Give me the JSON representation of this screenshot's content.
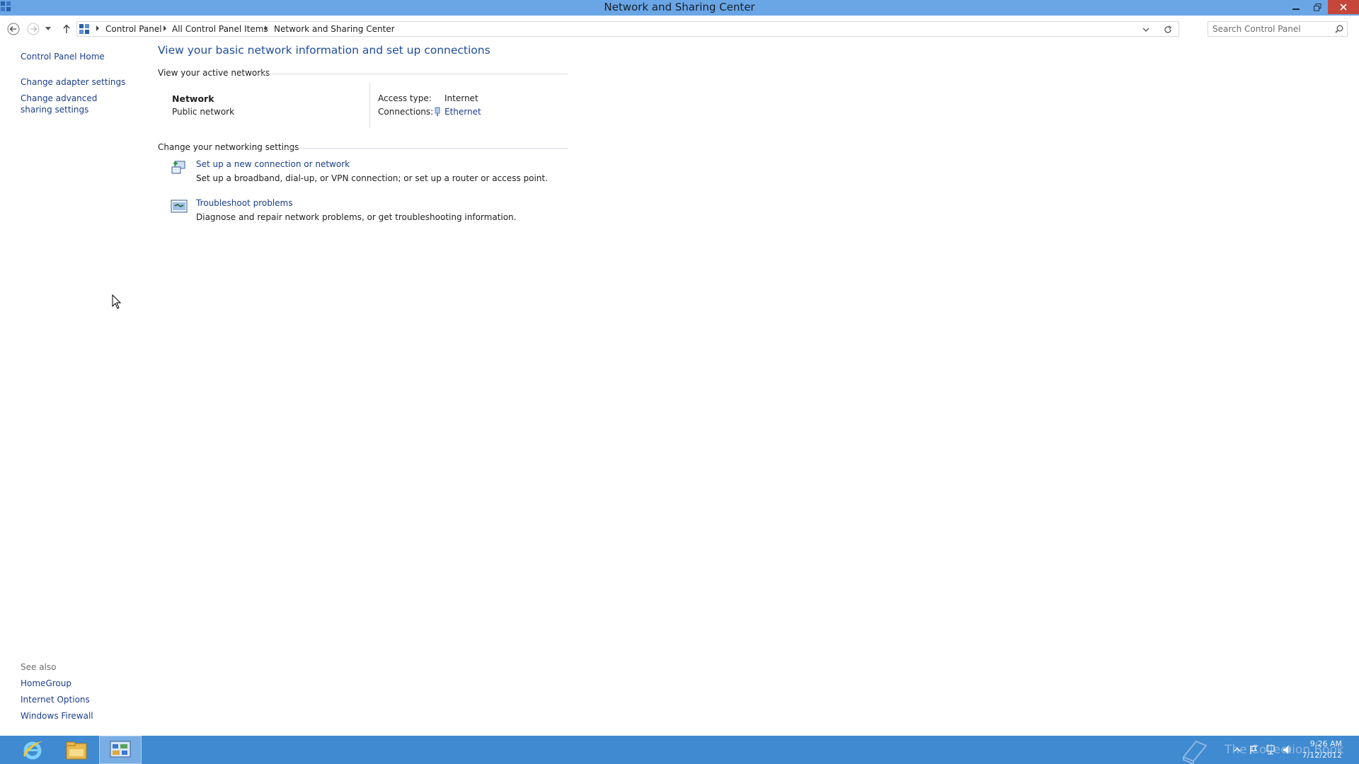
{
  "window": {
    "title": "Network and Sharing Center"
  },
  "nav": {
    "breadcrumbs": [
      "Control Panel",
      "All Control Panel Items",
      "Network and Sharing Center"
    ],
    "search_placeholder": "Search Control Panel"
  },
  "left_pane": {
    "links": [
      "Control Panel Home",
      "Change adapter settings",
      "Change advanced sharing settings"
    ],
    "see_also_header": "See also",
    "see_also": [
      "HomeGroup",
      "Internet Options",
      "Windows Firewall"
    ]
  },
  "main": {
    "heading": "View your basic network information and set up connections",
    "active_networks_header": "View your active networks",
    "network": {
      "name": "Network",
      "type": "Public network",
      "access_type_label": "Access type:",
      "access_type_value": "Internet",
      "connections_label": "Connections:",
      "connections_value": "Ethernet"
    },
    "settings_header": "Change your networking settings",
    "tasks": [
      {
        "link": "Set up a new connection or network",
        "description": "Set up a broadband, dial-up, or VPN connection; or set up a router or access point."
      },
      {
        "link": "Troubleshoot problems",
        "description": "Diagnose and repair network problems, or get troubleshooting information."
      }
    ]
  },
  "taskbar": {
    "watermark": "The Collection Book",
    "clock_time": "9:26 AM",
    "clock_date": "7/12/2012"
  },
  "colors": {
    "titlebar": "#6aa6e6",
    "taskbar": "#3f8ad0",
    "link": "#1a3e8a",
    "heading": "#1e4c9c",
    "close_button": "#c7463b"
  }
}
